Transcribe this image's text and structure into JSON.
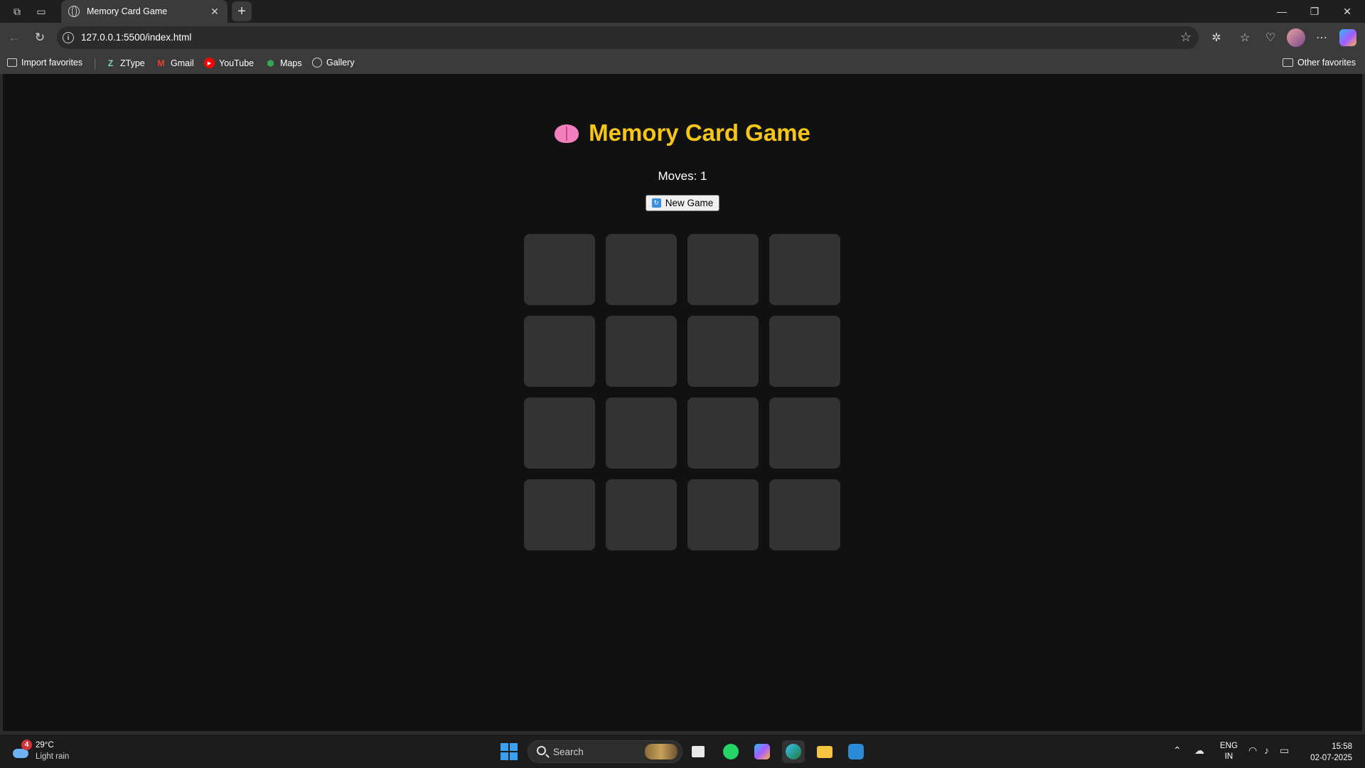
{
  "browser": {
    "tab": {
      "title": "Memory Card Game"
    },
    "address": {
      "url": "127.0.0.1:5500/index.html"
    },
    "favorites": [
      {
        "label": "Import favorites",
        "icon": "import-icon"
      },
      {
        "label": "ZType",
        "icon": "ztype-icon"
      },
      {
        "label": "Gmail",
        "icon": "gmail-icon"
      },
      {
        "label": "YouTube",
        "icon": "youtube-icon"
      },
      {
        "label": "Maps",
        "icon": "maps-icon"
      },
      {
        "label": "Gallery",
        "icon": "globe-icon"
      }
    ],
    "other_favorites": "Other favorites"
  },
  "game": {
    "title": "Memory Card Game",
    "title_icon": "brain-icon",
    "moves_label": "Moves: 1",
    "moves": 1,
    "new_game_label": "New Game",
    "grid": {
      "rows": 4,
      "cols": 4,
      "face_down_cards": 16
    },
    "colors": {
      "title": "#f5c518",
      "card_back": "#333333",
      "background": "#111111"
    }
  },
  "taskbar": {
    "weather": {
      "badge": "4",
      "temp": "29°C",
      "desc": "Light rain"
    },
    "search_placeholder": "Search",
    "lang_top": "ENG",
    "lang_bottom": "IN",
    "time": "15:58",
    "date": "02-07-2025"
  }
}
